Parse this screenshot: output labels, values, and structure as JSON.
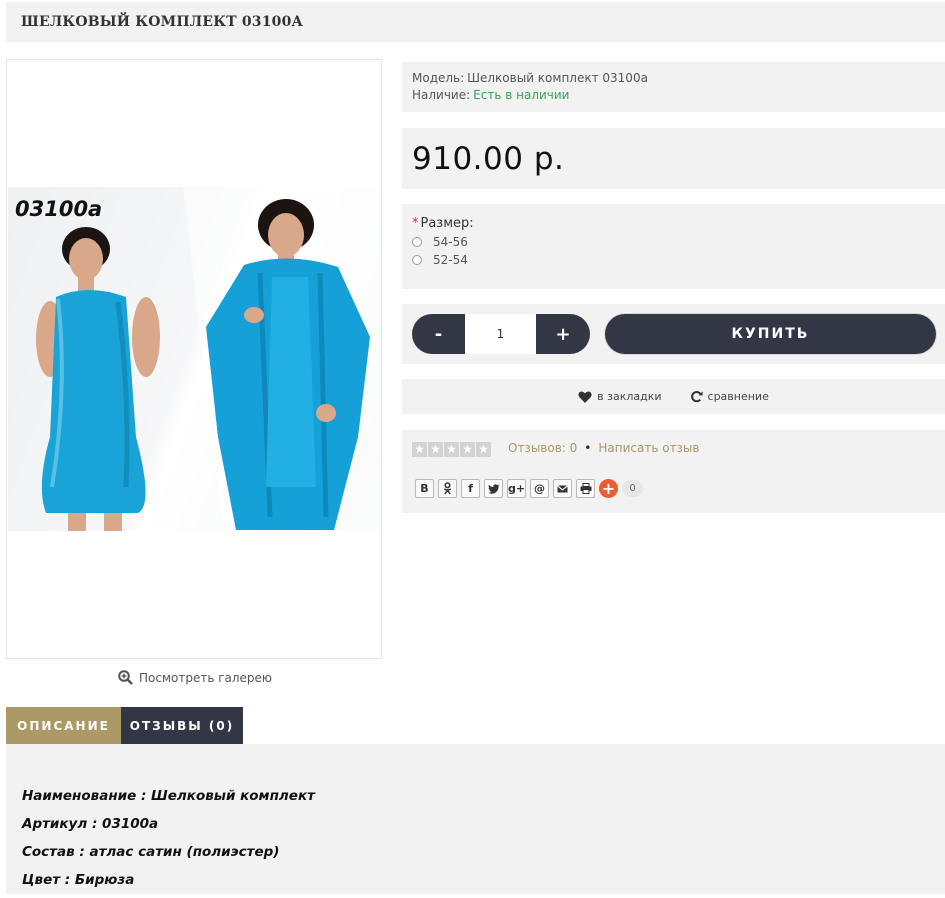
{
  "product": {
    "title": "ШЕЛКОВЫЙ КОМПЛЕКТ 03100А",
    "image_code": "03100a",
    "gallery_link": "Посмотреть галерею"
  },
  "info": {
    "model_label": "Модель:",
    "model_value": "Шелковый комплект 03100а",
    "stock_label": "Наличие:",
    "stock_value": "Есть в наличии"
  },
  "price": "910.00 р.",
  "size": {
    "label": "Размер:",
    "required_mark": "*",
    "options": [
      "54-56",
      "52-54"
    ]
  },
  "buy": {
    "minus": "-",
    "quantity": "1",
    "plus": "+",
    "button": "КУПИТЬ"
  },
  "actions": {
    "wishlist": "в закладки",
    "compare": "сравнение"
  },
  "reviews": {
    "rating": 0,
    "count_text": "Отзывов: 0",
    "separator": "•",
    "write": "Написать отзыв"
  },
  "share": {
    "buttons": [
      "В",
      "ok",
      "f",
      "twitter",
      "g+",
      "@",
      "email",
      "print"
    ],
    "count": "0"
  },
  "tabs": {
    "description": "ОПИСАНИЕ",
    "reviews": "ОТЗЫВЫ (0)"
  },
  "description": {
    "lines": [
      "Наименование : Шелковый комплект",
      "Артикул : 03100а",
      "Состав : атлас сатин (полиэстер)",
      "Цвет : Бирюза"
    ]
  },
  "colors": {
    "dark": "#333644",
    "gold": "#ab9966",
    "instock": "#3aa05a",
    "panel": "#f2f2f2",
    "dress": "#1aa3d6"
  }
}
